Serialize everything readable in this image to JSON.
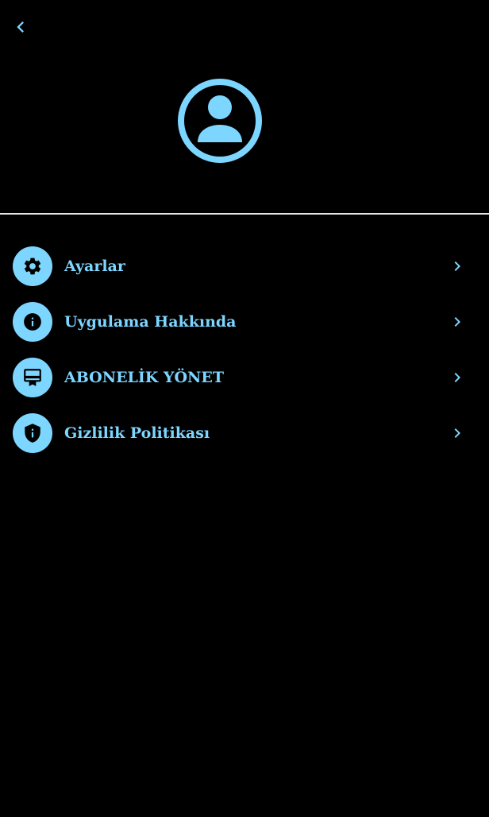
{
  "colors": {
    "background": "#000000",
    "accent": "#7dd6ff",
    "icon_glyph": "#000000",
    "divider": "#e6e6e6"
  },
  "header": {
    "back_icon": "chevron-left-icon"
  },
  "profile": {
    "avatar_icon": "account-circle-icon"
  },
  "menu": {
    "items": [
      {
        "label": "Ayarlar",
        "icon": "gear-icon"
      },
      {
        "label": "Uygulama Hakkında",
        "icon": "info-icon"
      },
      {
        "label": "ABONELİK YÖNET",
        "icon": "subscription-card-icon"
      },
      {
        "label": "Gizlilik Politikası",
        "icon": "shield-icon"
      }
    ]
  }
}
